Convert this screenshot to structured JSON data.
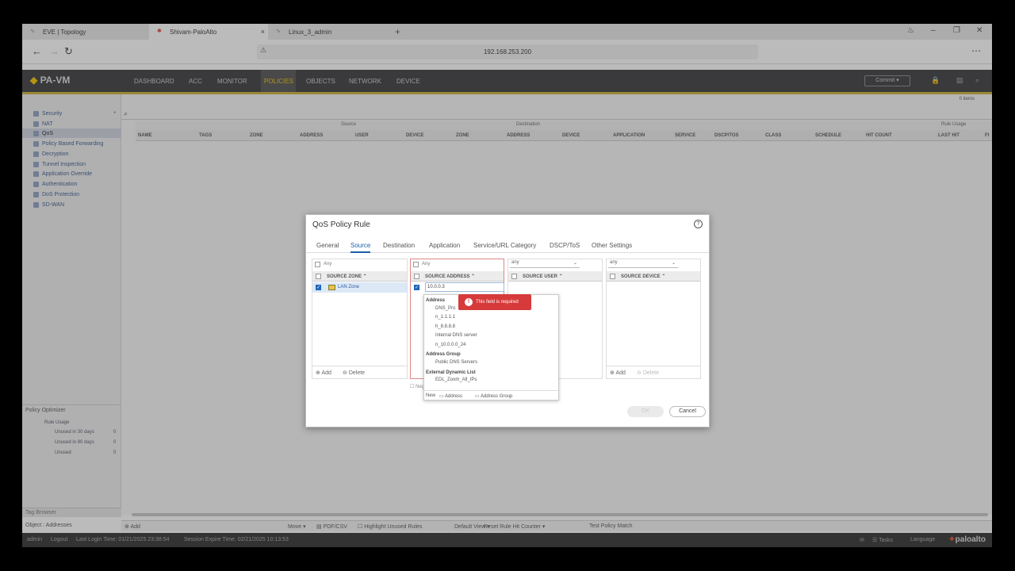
{
  "browser": {
    "tabs": [
      {
        "label": "EVE | Topology"
      },
      {
        "label": "Shivam-PaloAlto"
      },
      {
        "label": "Linux_3_admin"
      }
    ],
    "url": "192.168.253.200"
  },
  "app": {
    "logo": "PA-VM",
    "nav": [
      "DASHBOARD",
      "ACC",
      "MONITOR",
      "POLICIES",
      "OBJECTS",
      "NETWORK",
      "DEVICE"
    ],
    "commit_label": "Commit"
  },
  "sidebar": {
    "items": [
      "Security",
      "NAT",
      "QoS",
      "Policy Based Forwarding",
      "Decryption",
      "Tunnel Inspection",
      "Application Override",
      "Authentication",
      "DoS Protection",
      "SD-WAN"
    ],
    "optimizer": {
      "title": "Policy Optimizer",
      "rule_usage": "Rule Usage",
      "rows": [
        {
          "label": "Unused in 30 days",
          "count": "0"
        },
        {
          "label": "Unused in 90 days",
          "count": "0"
        },
        {
          "label": "Unused",
          "count": "0"
        }
      ]
    },
    "tag_browser": "Tag Browser",
    "object_addresses": "Object : Addresses"
  },
  "table": {
    "items_count": "0 items",
    "groups": {
      "source": "Source",
      "destination": "Destination",
      "rule_usage": "Rule Usage"
    },
    "columns": [
      "NAME",
      "TAGS",
      "ZONE",
      "ADDRESS",
      "USER",
      "DEVICE",
      "ZONE",
      "ADDRESS",
      "DEVICE",
      "APPLICATION",
      "SERVICE",
      "DSCP/TOS",
      "CLASS",
      "SCHEDULE",
      "HIT COUNT",
      "LAST HIT",
      "FI"
    ]
  },
  "bottombar": {
    "add": "Add",
    "move": "Move",
    "pdf": "PDF/CSV",
    "highlight": "Highlight Unused Rules",
    "default_view": "Default View",
    "reset": "Reset Rule Hit Counter",
    "test": "Test Policy Match"
  },
  "statusbar": {
    "user": "admin",
    "logout": "Logout",
    "last_login": "Last Login Time: 01/21/2025 23:38:54",
    "session": "Session Expire Time: 02/21/2025 10:13:53",
    "tasks": "Tasks",
    "language": "Language",
    "brand": "paloalto"
  },
  "dialog": {
    "title": "QoS Policy Rule",
    "tabs": [
      "General",
      "Source",
      "Destination",
      "Application",
      "Service/URL Category",
      "DSCP/ToS",
      "Other Settings"
    ],
    "zone_panel": {
      "any": "Any",
      "header": "SOURCE ZONE",
      "row": "LAN Zone",
      "add": "Add",
      "delete": "Delete"
    },
    "addr_panel": {
      "any": "Any",
      "header": "SOURCE ADDRESS",
      "input_value": "10.0.0.3",
      "negate": "Negate"
    },
    "user_panel": {
      "select": "any",
      "header": "SOURCE USER"
    },
    "device_panel": {
      "select": "any",
      "header": "SOURCE DEVICE",
      "add": "Add",
      "delete": "Delete"
    },
    "error": "This field is required",
    "dropdown": {
      "address_group_label": "Address",
      "addresses": [
        "DNS_Pro",
        "n_1.1.1.1",
        "h_8.8.8.8",
        "Internal DNS server",
        "n_10.0.0.0_24"
      ],
      "addr_group_label": "Address Group",
      "addr_groups": [
        "Public DNS Servers"
      ],
      "edl_label": "External Dynamic List",
      "edls": [
        "EDL_Zoom_All_IPs"
      ],
      "new": "New",
      "new_address": "Address",
      "new_address_group": "Address Group"
    },
    "ok": "OK",
    "cancel": "Cancel"
  }
}
